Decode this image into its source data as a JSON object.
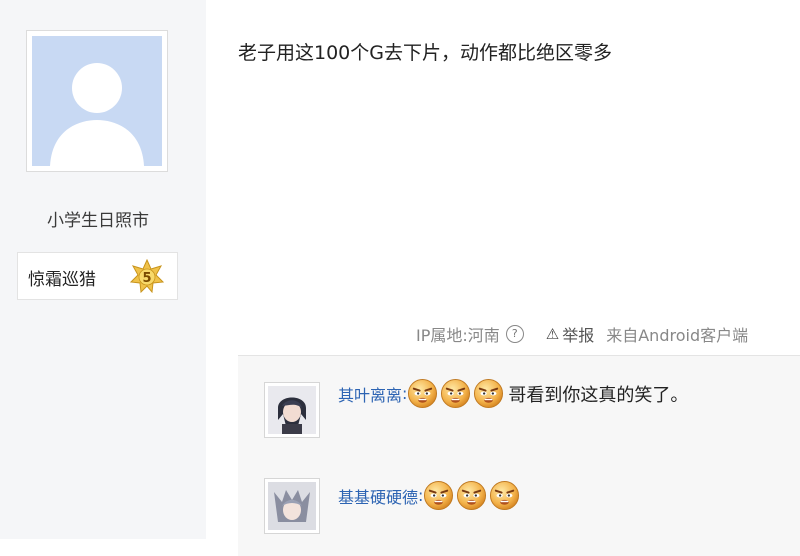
{
  "user": {
    "name": "小学生日照市",
    "title": "惊霜巡猎",
    "level": "5"
  },
  "post": {
    "text": "老子用这100个G去下片，动作都比绝区零多"
  },
  "meta": {
    "ip_location": "IP属地:河南",
    "help_icon": "?",
    "report_label": "举报",
    "source": "来自Android客户端"
  },
  "comments": [
    {
      "user": "其叶离离",
      "separator": ":",
      "emoji": [
        "angry-face-icon",
        "angry-face-icon",
        "angry-face-icon"
      ],
      "text": "哥看到你这真的笑了。"
    },
    {
      "user": "基基硬硬德",
      "separator": ":",
      "emoji": [
        "angry-face-icon",
        "angry-face-icon",
        "angry-face-icon"
      ],
      "text": ""
    }
  ],
  "colors": {
    "sidebar_bg": "#f5f6f8",
    "link": "#2d64b3",
    "avatar_bg": "#c8d9f3"
  }
}
